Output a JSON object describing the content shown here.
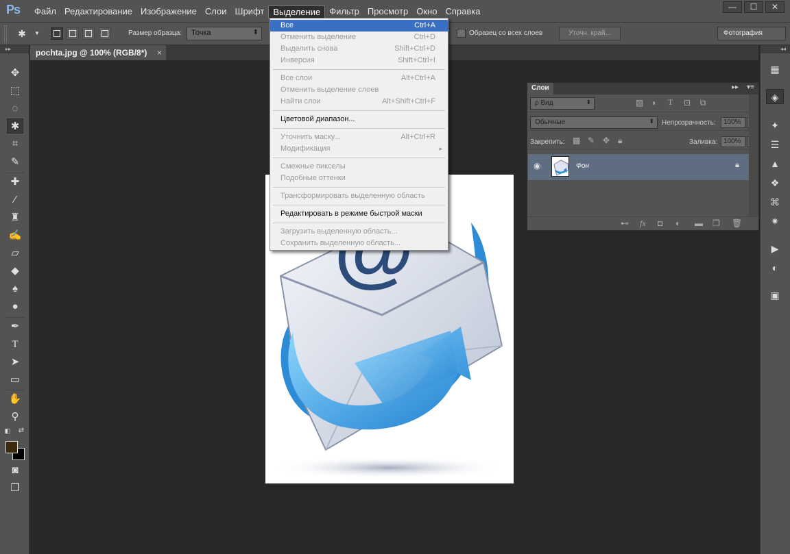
{
  "app": {
    "logo": "Ps"
  },
  "menu": [
    "Файл",
    "Редактирование",
    "Изображение",
    "Слои",
    "Шрифт",
    "Выделение",
    "Фильтр",
    "Просмотр",
    "Окно",
    "Справка"
  ],
  "window_controls": {
    "minimize": "—",
    "maximize": "☐",
    "close": "✕"
  },
  "options": {
    "sample_size_label": "Размер образца:",
    "sample_size_value": "Точка",
    "sample_all_layers_label": "Образец со всех слоев",
    "refine_edge_label": "Уточн. край...",
    "workspace_label": "Фотография"
  },
  "document_tab": {
    "title": "pochta.jpg @ 100% (RGB/8*)",
    "close": "×"
  },
  "toolbar_head": "▸▸",
  "dock_head": "◂◂",
  "layers_panel": {
    "tab_label": "Слои",
    "filter_label": "ρ Вид",
    "blend_mode": "Обычные",
    "opacity_label": "Непрозрачность:",
    "opacity_value": "100%",
    "lock_label": "Закрепить:",
    "fill_label": "Заливка:",
    "fill_value": "100%",
    "layer_name": "Фон"
  },
  "selection_menu": {
    "groups": [
      [
        {
          "label": "Все",
          "shortcut": "Ctrl+A",
          "enabled": true,
          "hover": true
        },
        {
          "label": "Отменить выделение",
          "shortcut": "Ctrl+D",
          "enabled": false
        },
        {
          "label": "Выделить снова",
          "shortcut": "Shift+Ctrl+D",
          "enabled": false
        },
        {
          "label": "Инверсия",
          "shortcut": "Shift+Ctrl+I",
          "enabled": false
        }
      ],
      [
        {
          "label": "Все слои",
          "shortcut": "Alt+Ctrl+A",
          "enabled": false
        },
        {
          "label": "Отменить выделение слоев",
          "shortcut": "",
          "enabled": false
        },
        {
          "label": "Найти слои",
          "shortcut": "Alt+Shift+Ctrl+F",
          "enabled": false
        }
      ],
      [
        {
          "label": "Цветовой диапазон...",
          "shortcut": "",
          "enabled": true
        }
      ],
      [
        {
          "label": "Уточнить маску...",
          "shortcut": "Alt+Ctrl+R",
          "enabled": false
        },
        {
          "label": "Модификация",
          "shortcut": "",
          "enabled": false,
          "submenu": true
        }
      ],
      [
        {
          "label": "Смежные пикселы",
          "shortcut": "",
          "enabled": false
        },
        {
          "label": "Подобные оттенки",
          "shortcut": "",
          "enabled": false
        }
      ],
      [
        {
          "label": "Трансформировать выделенную область",
          "shortcut": "",
          "enabled": false
        }
      ],
      [
        {
          "label": "Редактировать в режиме быстрой маски",
          "shortcut": "",
          "enabled": true
        }
      ],
      [
        {
          "label": "Загрузить выделенную область...",
          "shortcut": "",
          "enabled": false
        },
        {
          "label": "Сохранить выделенную область...",
          "shortcut": "",
          "enabled": false
        }
      ]
    ]
  },
  "colors": {
    "hover": "#3b6fc4",
    "foreground": "#3a2a10",
    "background": "#000000"
  }
}
